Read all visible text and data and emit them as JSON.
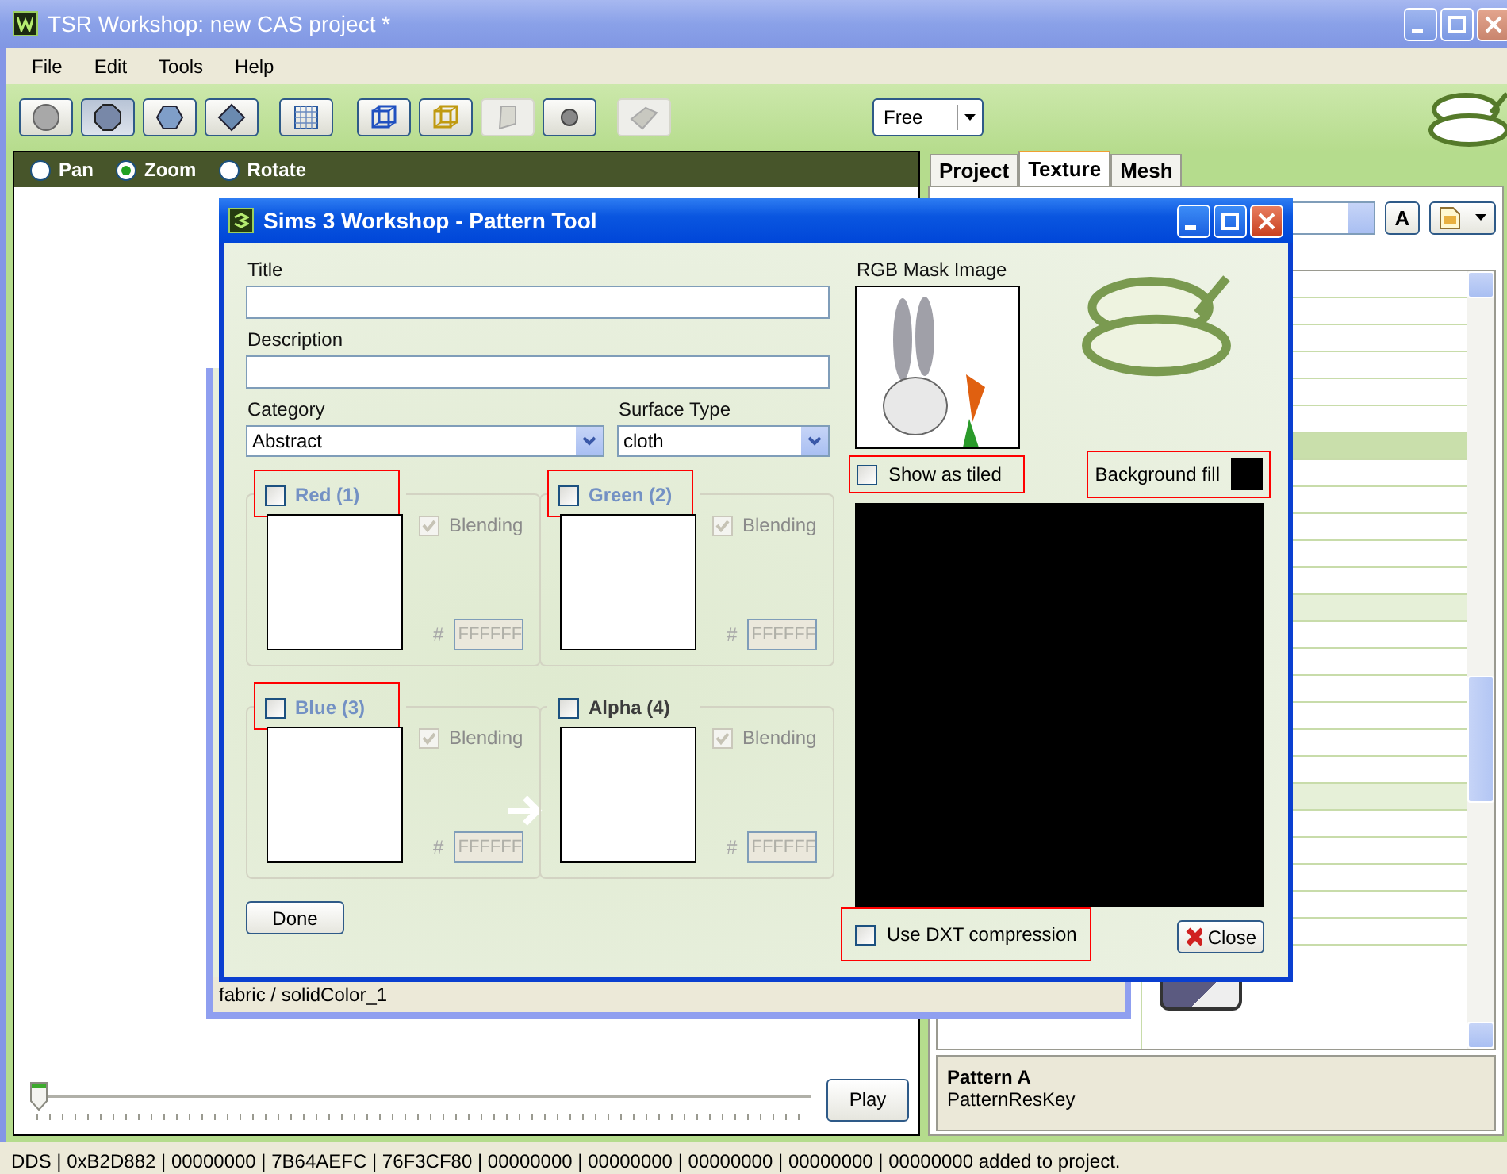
{
  "window": {
    "title": "TSR Workshop: new CAS project *"
  },
  "menu": [
    {
      "label": "File"
    },
    {
      "label": "Edit"
    },
    {
      "label": "Tools"
    },
    {
      "label": "Help"
    }
  ],
  "toolbar": {
    "buttons": [
      {
        "kind": "sphere",
        "selected": false,
        "disabled": false
      },
      {
        "kind": "octagon",
        "selected": true,
        "disabled": false
      },
      {
        "kind": "hexagon",
        "selected": false,
        "disabled": false
      },
      {
        "kind": "diamond",
        "selected": false,
        "disabled": false
      },
      {
        "kind": "grid",
        "selected": false,
        "disabled": false
      },
      {
        "kind": "cube",
        "selected": false,
        "disabled": false
      },
      {
        "kind": "cube-gold",
        "selected": false,
        "disabled": false
      },
      {
        "kind": "plane",
        "selected": false,
        "disabled": true
      },
      {
        "kind": "dot",
        "selected": false,
        "disabled": false
      },
      {
        "kind": "flat",
        "selected": false,
        "disabled": true
      }
    ],
    "view_combo": "Free"
  },
  "viewport": {
    "modes": [
      {
        "label": "Pan",
        "selected": false
      },
      {
        "label": "Zoom",
        "selected": true
      },
      {
        "label": "Rotate",
        "selected": false
      }
    ],
    "timeline": {
      "level": 0
    },
    "play_button": "Play"
  },
  "right_panel": {
    "tabs": [
      {
        "label": "Project",
        "selected": false
      },
      {
        "label": "Texture",
        "selected": true
      },
      {
        "label": "Mesh",
        "selected": false
      }
    ],
    "font_button": "A",
    "property": {
      "name": "Pattern A",
      "description": "PatternResKey"
    }
  },
  "background_window": {
    "status": "fabric / solidColor_1"
  },
  "dialog": {
    "title": "Sims 3 Workshop - Pattern Tool",
    "fields": [
      {
        "label": "Title"
      },
      {
        "label": "Description"
      }
    ],
    "category": {
      "label": "Category",
      "value": "Abstract"
    },
    "surface_type": {
      "label": "Surface Type",
      "value": "cloth"
    },
    "channels": [
      {
        "name": "Red (1)",
        "checked": false,
        "disabled": true,
        "highlighted": true,
        "blending": true,
        "blending_label": "Blending",
        "hash": "#",
        "hex": "FFFFFF"
      },
      {
        "name": "Green (2)",
        "checked": false,
        "disabled": true,
        "highlighted": true,
        "blending": true,
        "blending_label": "Blending",
        "hash": "#",
        "hex": "FFFFFF"
      },
      {
        "name": "Blue (3)",
        "checked": false,
        "disabled": true,
        "highlighted": true,
        "blending": true,
        "blending_label": "Blending",
        "hash": "#",
        "hex": "FFFFFF"
      },
      {
        "name": "Alpha (4)",
        "checked": false,
        "disabled": false,
        "highlighted": false,
        "blending": true,
        "blending_label": "Blending",
        "hash": "#",
        "hex": "FFFFFF"
      }
    ],
    "mask_label": "RGB Mask Image",
    "show_tiled": {
      "label": "Show as tiled",
      "checked": false,
      "highlighted": true
    },
    "background_fill": {
      "label": "Background fill",
      "highlighted": true
    },
    "dxt": {
      "label": "Use DXT compression",
      "checked": false,
      "highlighted": true
    },
    "done_button": "Done",
    "close_button": "Close"
  },
  "status_bar": "DDS | 0xB2D882 | 00000000 | 7B64AEFC | 76F3CF80 | 00000000 | 00000000 | 00000000 | 00000000 | 00000000 added to project."
}
